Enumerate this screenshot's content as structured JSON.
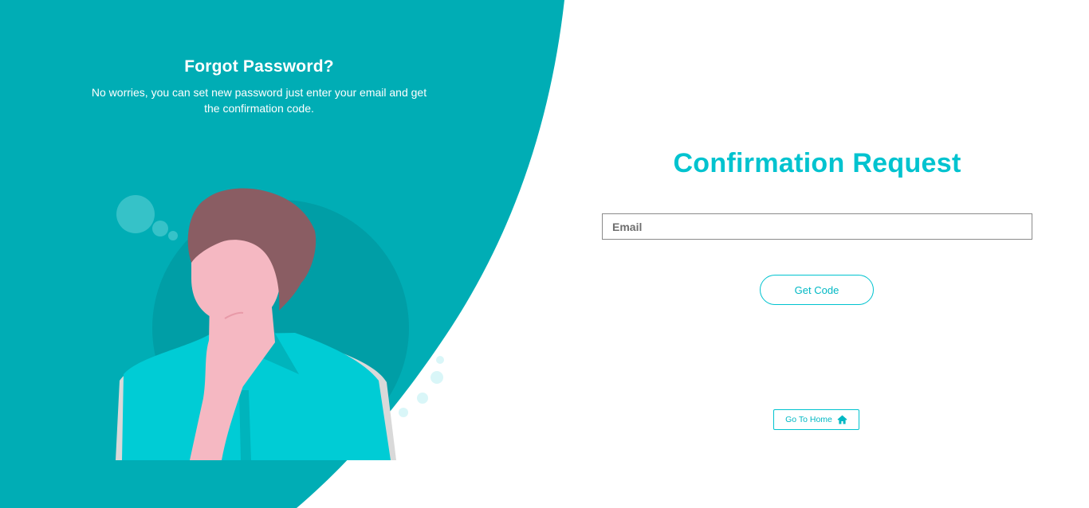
{
  "left_panel": {
    "title": "Forgot Password?",
    "subtitle_line1": "No worries, you can set new password just enter your email and get",
    "subtitle_line2": "the confirmation code."
  },
  "form": {
    "title": "Confirmation Request",
    "email_placeholder": "Email",
    "email_value": "",
    "get_code_label": "Get Code",
    "go_home_label": "Go To Home"
  },
  "icons": {
    "home": "home-icon"
  },
  "colors": {
    "teal_panel": "#00adb5",
    "accent": "#00c3cf",
    "hair": "#8a5d63",
    "skin": "#f5b8c2",
    "shirt": "#00ccd5"
  }
}
